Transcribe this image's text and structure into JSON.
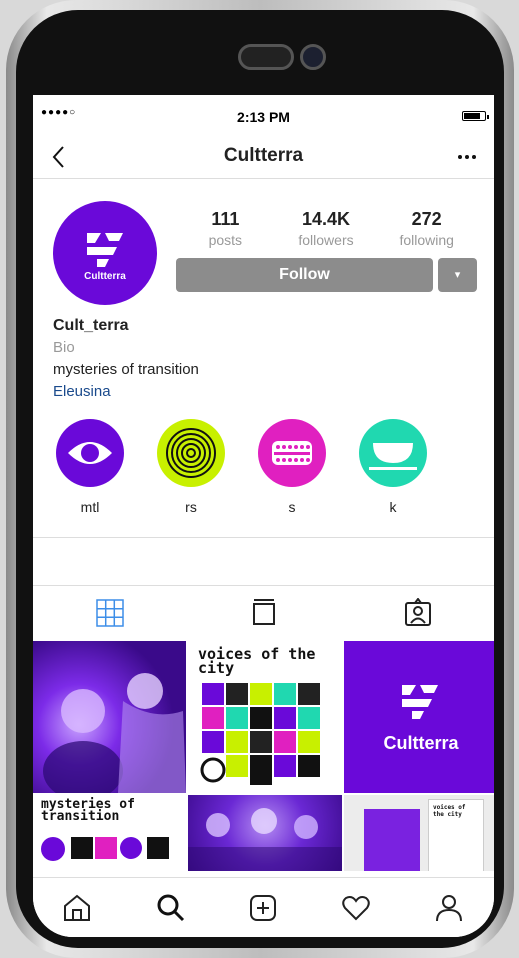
{
  "status": {
    "signal": "●●●●○",
    "time": "2:13 PM"
  },
  "nav": {
    "back_icon": "chevron-left-icon",
    "title": "Cultterra",
    "more_icon": "more-horizontal-icon"
  },
  "profile": {
    "avatar_text": "Cultterra",
    "stats": [
      {
        "value": "111",
        "label": "posts"
      },
      {
        "value": "14.4K",
        "label": "followers"
      },
      {
        "value": "272",
        "label": "following"
      }
    ],
    "follow_label": "Follow",
    "dropdown_icon": "▾",
    "name": "Cult_terra",
    "bio_label": "Bio",
    "bio_text": "mysteries of transition",
    "location": "Eleusina"
  },
  "highlights": [
    {
      "label": "mtl",
      "icon": "eye-icon",
      "color": "#6a09d9"
    },
    {
      "label": "rs",
      "icon": "spiral-icon",
      "color": "#c8f000"
    },
    {
      "label": "s",
      "icon": "dots-icon",
      "color": "#e020c0"
    },
    {
      "label": "k",
      "icon": "bowl-icon",
      "color": "#20d8b0"
    }
  ],
  "tabs": [
    {
      "name": "grid-tab",
      "icon": "grid-icon",
      "active": true
    },
    {
      "name": "feed-tab",
      "icon": "list-icon",
      "active": false
    },
    {
      "name": "tagged-tab",
      "icon": "tagged-icon",
      "active": false
    }
  ],
  "grid": [
    {
      "kind": "photo-crowd-purple"
    },
    {
      "kind": "poster",
      "text": "voices of the city"
    },
    {
      "kind": "logo",
      "text": "Cultterra"
    },
    {
      "kind": "poster2",
      "text": "mysteries of transition"
    },
    {
      "kind": "photo-group-purple"
    },
    {
      "kind": "booklets",
      "text": "voices of the city"
    }
  ],
  "bottom_nav": [
    "home-icon",
    "search-icon",
    "add-post-icon",
    "heart-icon",
    "profile-icon"
  ],
  "colors": {
    "brand_purple": "#6a09d9",
    "lime": "#c8f000",
    "magenta": "#e020c0",
    "teal": "#20d8b0",
    "follow_grey": "#8c8c8c",
    "link_blue": "#1a4a8c"
  }
}
